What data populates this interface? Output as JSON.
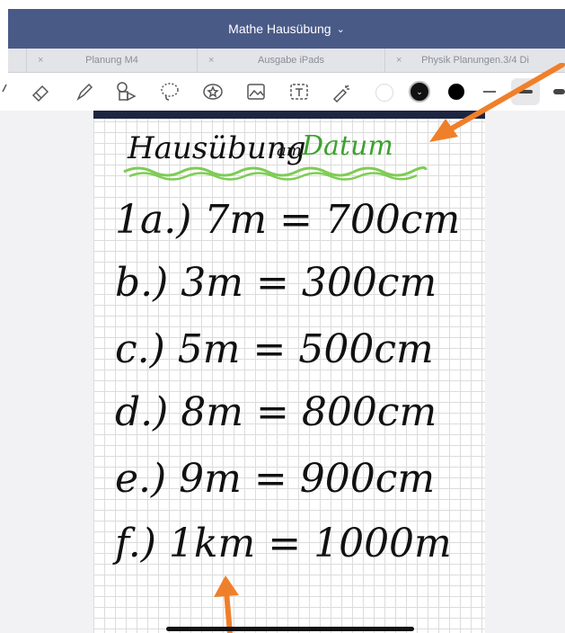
{
  "titlebar": {
    "title": "Mathe Hausübung"
  },
  "tabs": [
    {
      "label": ""
    },
    {
      "label": "Planung M4"
    },
    {
      "label": "Ausgabe iPads"
    },
    {
      "label": "Physik Planungen.3/4 Di"
    }
  ],
  "toolbar": {
    "tools": [
      "back-icon",
      "eraser-icon",
      "pen-icon",
      "highlighter-icon",
      "shapes-icon",
      "lasso-icon",
      "sticker-icon",
      "image-icon",
      "textbox-icon",
      "laser-icon"
    ],
    "colors": [
      "#ffffff",
      "#111111",
      "#000000"
    ],
    "stroke_widths": [
      "thin",
      "medium",
      "thick"
    ]
  },
  "document": {
    "heading_black": "Hausübung",
    "heading_sep": "am",
    "heading_green": "Datum",
    "lines": [
      "1a.) 7m = 700cm",
      "b.) 3m = 300cm",
      "c.) 5m = 500cm",
      "d.) 8m = 800cm",
      "e.) 9m = 900cm",
      "f.) 1km = 1000m"
    ]
  },
  "colors": {
    "accent": "#4a5a87",
    "green_ink": "#3da12f",
    "arrow": "#f07f2a"
  }
}
